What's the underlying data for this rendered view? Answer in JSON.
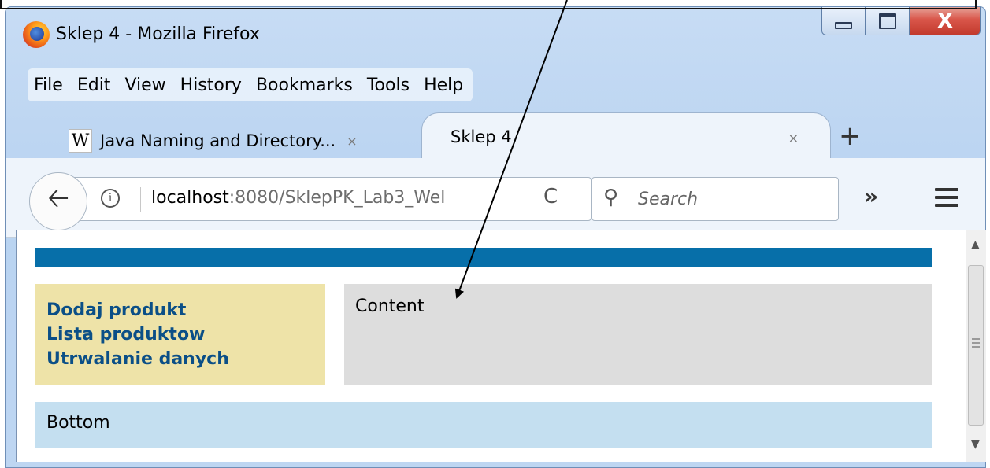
{
  "window": {
    "title": "Sklep 4 - Mozilla Firefox",
    "controls": {
      "close_glyph": "X"
    }
  },
  "menubar": {
    "items": [
      "File",
      "Edit",
      "View",
      "History",
      "Bookmarks",
      "Tools",
      "Help"
    ]
  },
  "tabs": [
    {
      "label": "Java Naming and Directory...",
      "icon": "wikipedia-icon",
      "active": false
    },
    {
      "label": "Sklep 4",
      "active": true
    }
  ],
  "tab_close_glyph": "×",
  "new_tab_glyph": "+",
  "navbar": {
    "back_glyph": "🡠",
    "info_glyph": "i",
    "url_host": "localhost",
    "url_path": ":8080/SklepPK_Lab3_Wel",
    "reload_glyph": "C",
    "search_glyph": "⚲",
    "search_placeholder": "Search",
    "overflow_glyph": "»"
  },
  "page": {
    "menu_links": [
      "Dodaj produkt",
      "Lista produktow",
      "Utrwalanie danych"
    ],
    "content_text": "Content",
    "bottom_text": "Bottom",
    "colors": {
      "banner": "#076fa9",
      "menu_bg": "#eee3a8",
      "content_bg": "#dddddd",
      "bottom_bg": "#c4dff0",
      "link": "#0b4f87"
    }
  },
  "scrollbar": {
    "up_glyph": "▲",
    "down_glyph": "▼"
  }
}
